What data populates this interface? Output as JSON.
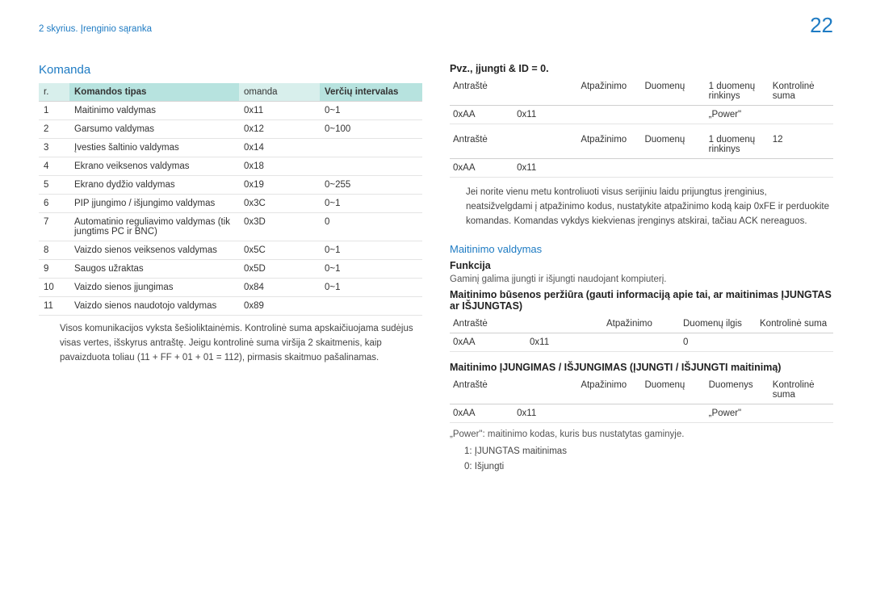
{
  "header": {
    "breadcrumb": "2 skyrius. Įrenginio sąranka",
    "page_number": "22"
  },
  "left": {
    "title": "Komanda",
    "table": {
      "headers": {
        "nr": "r.",
        "type": "Komandos tipas",
        "cmd": "omanda",
        "range": "Verčių intervalas"
      },
      "rows": [
        {
          "nr": "1",
          "type": "Maitinimo valdymas",
          "cmd": "0x11",
          "range": "0~1"
        },
        {
          "nr": "2",
          "type": "Garsumo valdymas",
          "cmd": "0x12",
          "range": "0~100"
        },
        {
          "nr": "3",
          "type": "Įvesties šaltinio valdymas",
          "cmd": "0x14",
          "range": ""
        },
        {
          "nr": "4",
          "type": "Ekrano veiksenos valdymas",
          "cmd": "0x18",
          "range": ""
        },
        {
          "nr": "5",
          "type": "Ekrano dydžio valdymas",
          "cmd": "0x19",
          "range": "0~255"
        },
        {
          "nr": "6",
          "type": "PIP įjungimo / išjungimo valdymas",
          "cmd": "0x3C",
          "range": "0~1"
        },
        {
          "nr": "7",
          "type": "Automatinio reguliavimo valdymas (tik jungtims PC ir BNC)",
          "cmd": "0x3D",
          "range": "0"
        },
        {
          "nr": "8",
          "type": "Vaizdo sienos veiksenos valdymas",
          "cmd": "0x5C",
          "range": "0~1"
        },
        {
          "nr": "9",
          "type": "Saugos užraktas",
          "cmd": "0x5D",
          "range": "0~1"
        },
        {
          "nr": "10",
          "type": "Vaizdo sienos įjungimas",
          "cmd": "0x84",
          "range": "0~1"
        },
        {
          "nr": "11",
          "type": "Vaizdo sienos naudotojo valdymas",
          "cmd": "0x89",
          "range": ""
        }
      ]
    },
    "note": "Visos komunikacijos vyksta šešioliktainėmis. Kontrolinė suma apskaičiuojama sudėjus visas vertes, išskyrus antraštę. Jeigu kontrolinė suma viršija 2 skaitmenis, kaip pavaizduota toliau (11 + FF + 01 + 01 = 112), pirmasis skaitmuo pašalinamas."
  },
  "right": {
    "example_title": "Pvz., įjungti & ID = 0.",
    "pkt_headers": {
      "antraste": "Antraštė",
      "atpazinimo": "Atpažinimo",
      "duomenu": "Duomenų",
      "rinkinys": "1 duomenų rinkinys",
      "kontroline": "Kontrolinė suma",
      "ilgis": "Duomenų ilgis",
      "duomenys": "Duomenys",
      "twelve": "12"
    },
    "pkt_vals": {
      "aa": "0xAA",
      "c11": "0x11",
      "power": "„Power\"",
      "zero": "0"
    },
    "bridge_note": "Jei norite vienu metu kontroliuoti visus serijiniu laidu prijungtus įrenginius, neatsižvelgdami į atpažinimo kodus, nustatykite atpažinimo kodą kaip 0xFE ir perduokite komandas. Komandas vykdys kiekvienas įrenginys atskirai, tačiau ACK nereaguos.",
    "power_title": "Maitinimo valdymas",
    "func_label": "Funkcija",
    "func_desc": "Gaminį galima įjungti ir išjungti naudojant kompiuterį.",
    "status_title": "Maitinimo būsenos peržiūra (gauti informaciją apie tai, ar maitinimas ĮJUNGTAS ar IŠJUNGTAS)",
    "onoff_title": "Maitinimo ĮJUNGIMAS / IŠJUNGIMAS (ĮJUNGTI / IŠJUNGTI maitinimą)",
    "power_note": "„Power\": maitinimo kodas, kuris bus nustatytas gaminyje.",
    "power_on": "1: ĮJUNGTAS maitinimas",
    "power_off": "0: Išjungti"
  }
}
